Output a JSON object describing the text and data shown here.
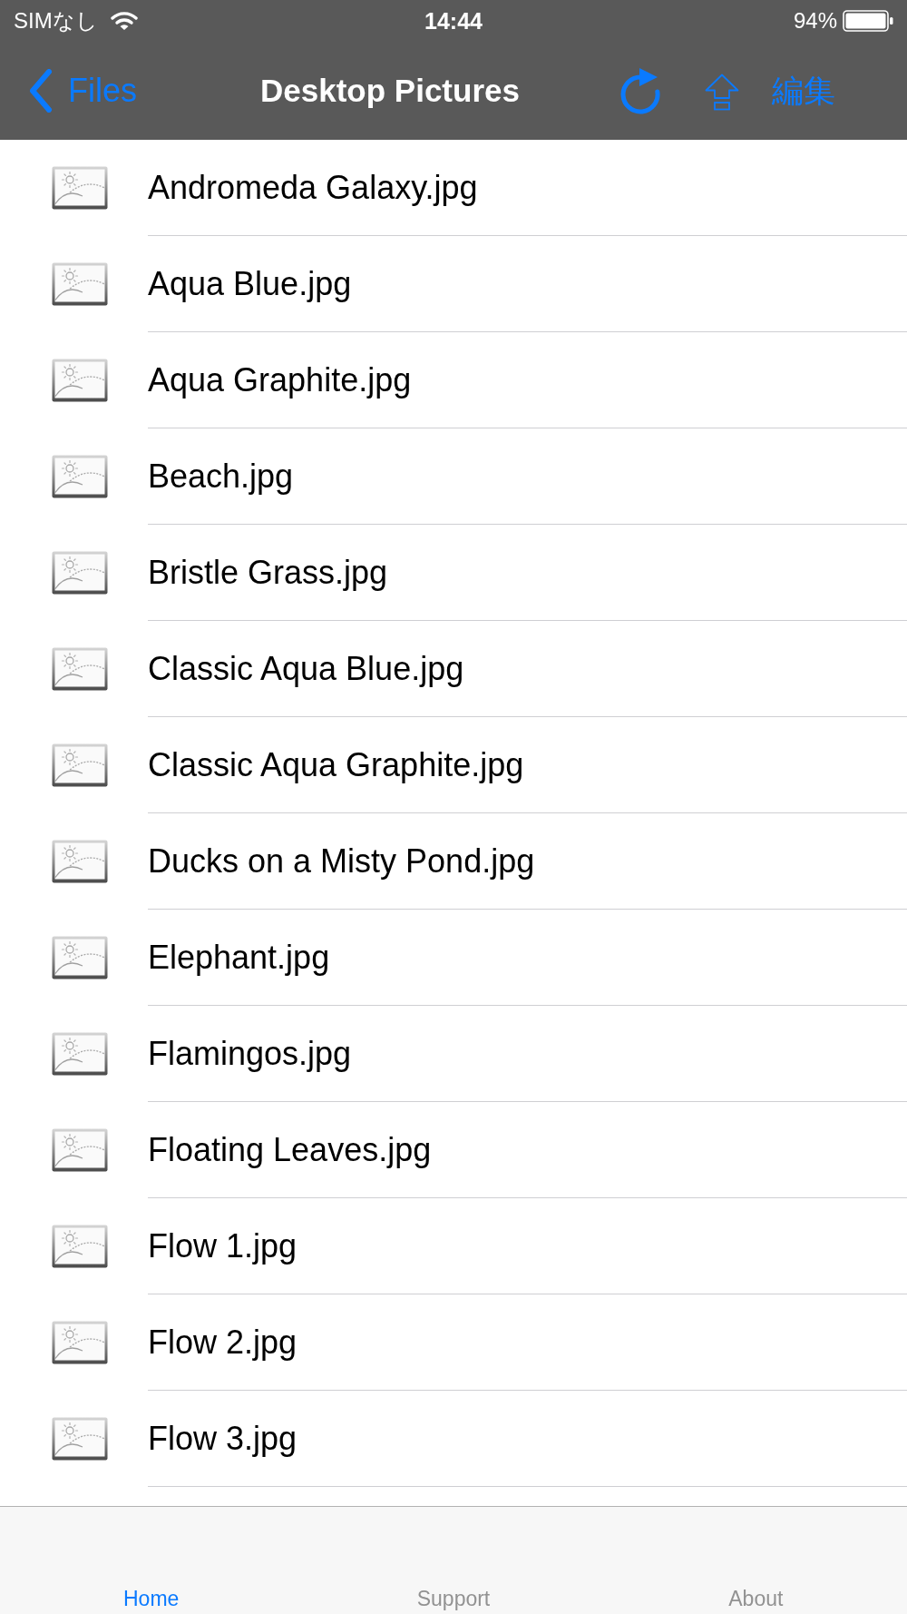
{
  "status_bar": {
    "carrier": "SIMなし",
    "time": "14:44",
    "battery": "94%"
  },
  "nav_bar": {
    "back": "Files",
    "title": "Desktop Pictures",
    "edit": "編集"
  },
  "files": [
    {
      "name": "Andromeda Galaxy.jpg"
    },
    {
      "name": "Aqua Blue.jpg"
    },
    {
      "name": "Aqua Graphite.jpg"
    },
    {
      "name": "Beach.jpg"
    },
    {
      "name": "Bristle Grass.jpg"
    },
    {
      "name": "Classic Aqua Blue.jpg"
    },
    {
      "name": "Classic Aqua Graphite.jpg"
    },
    {
      "name": "Ducks on a Misty Pond.jpg"
    },
    {
      "name": "Elephant.jpg"
    },
    {
      "name": "Flamingos.jpg"
    },
    {
      "name": "Floating Leaves.jpg"
    },
    {
      "name": "Flow 1.jpg"
    },
    {
      "name": "Flow 2.jpg"
    },
    {
      "name": "Flow 3.jpg"
    }
  ],
  "tab_bar": [
    {
      "label": "Home",
      "selected": true
    },
    {
      "label": "Support",
      "selected": false
    },
    {
      "label": "About",
      "selected": false
    }
  ]
}
